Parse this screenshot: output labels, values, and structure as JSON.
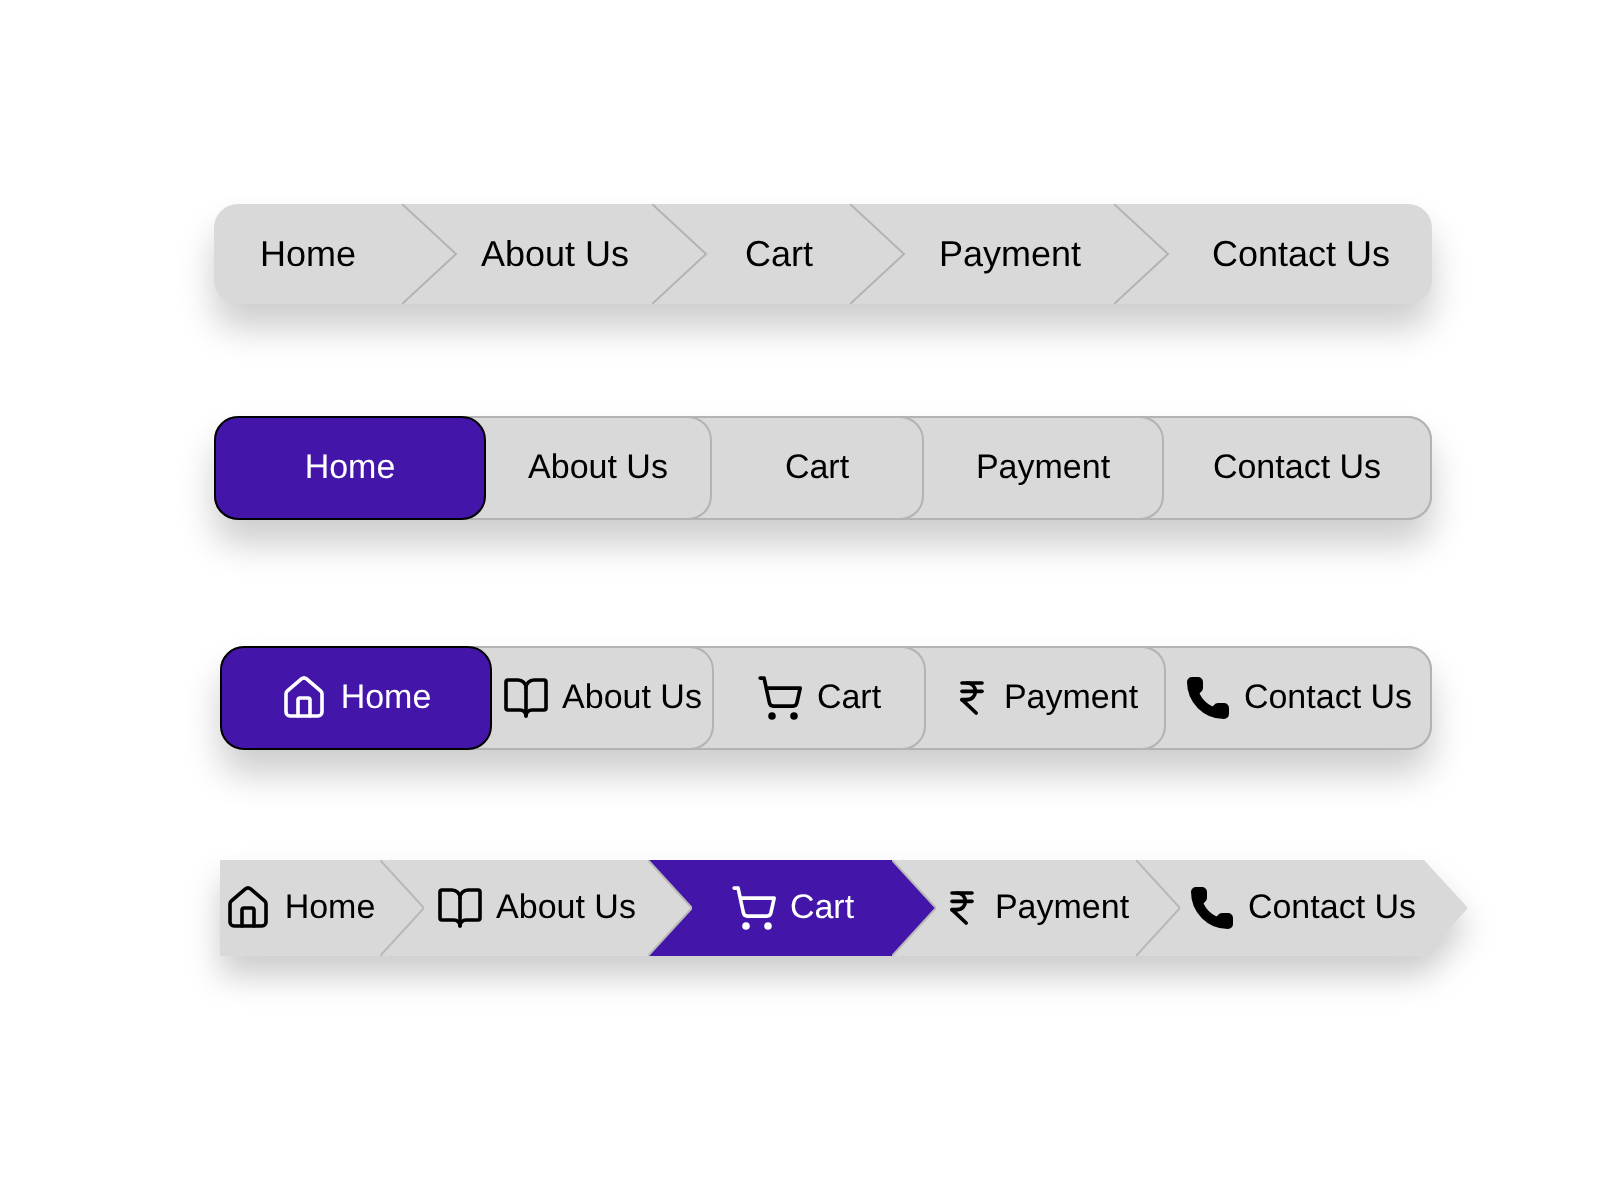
{
  "bars": [
    {
      "kind": "chevron",
      "items": [
        {
          "label": "Home",
          "selected": false
        },
        {
          "label": "About Us",
          "selected": false
        },
        {
          "label": "Cart",
          "selected": false
        },
        {
          "label": "Payment",
          "selected": false
        },
        {
          "label": "Contact Us",
          "selected": false
        }
      ]
    },
    {
      "kind": "tabs",
      "items": [
        {
          "label": "Home",
          "selected": true
        },
        {
          "label": "About Us",
          "selected": false
        },
        {
          "label": "Cart",
          "selected": false
        },
        {
          "label": "Payment",
          "selected": false
        },
        {
          "label": "Contact Us",
          "selected": false
        }
      ]
    },
    {
      "kind": "icon-tabs",
      "items": [
        {
          "label": "Home",
          "selected": true
        },
        {
          "label": "About Us",
          "selected": false
        },
        {
          "label": "Cart",
          "selected": false
        },
        {
          "label": "Payment",
          "selected": false
        },
        {
          "label": "Contact Us",
          "selected": false
        }
      ]
    },
    {
      "kind": "arrows",
      "items": [
        {
          "label": "Home",
          "selected": false
        },
        {
          "label": "About Us",
          "selected": false
        },
        {
          "label": "Cart",
          "selected": true
        },
        {
          "label": "Payment",
          "selected": false
        },
        {
          "label": "Contact Us",
          "selected": false
        }
      ]
    }
  ]
}
